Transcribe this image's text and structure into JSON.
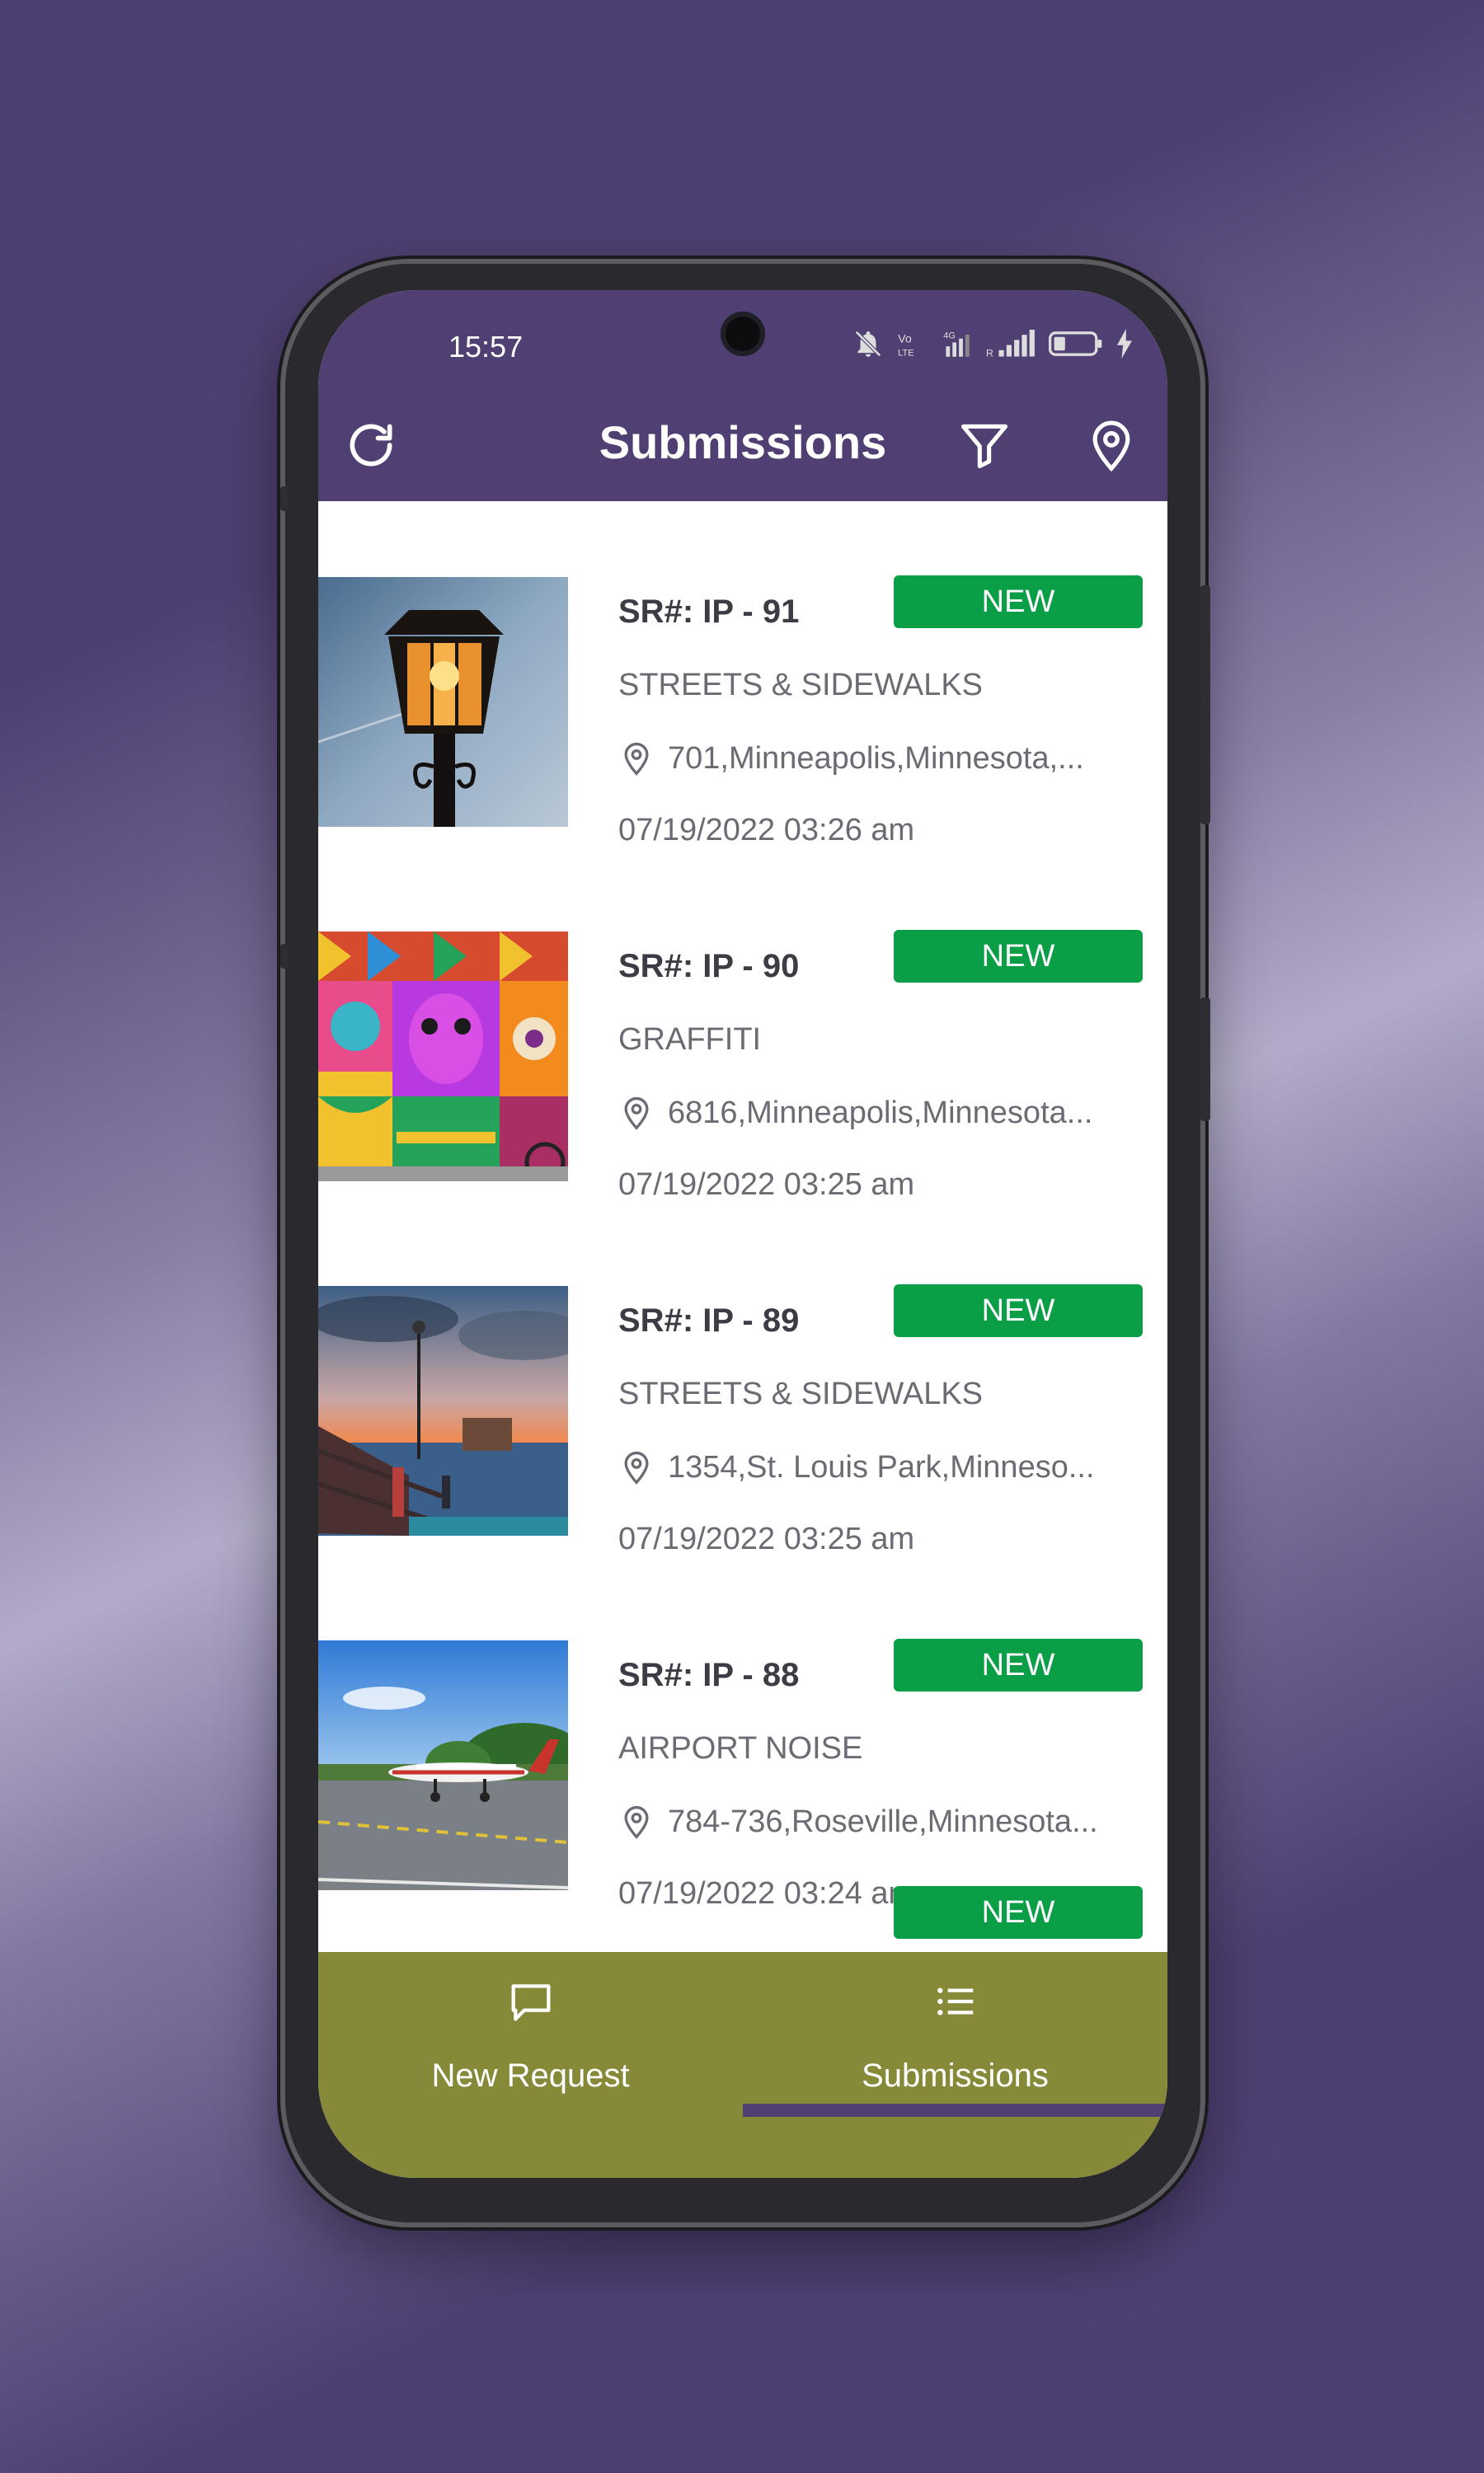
{
  "statusbar": {
    "time": "15:57"
  },
  "appbar": {
    "title": "Submissions"
  },
  "submissions": [
    {
      "sr": "SR#: IP - 91",
      "status": "NEW",
      "category": "STREETS & SIDEWALKS",
      "address": "701,Minneapolis,Minnesota,...",
      "date": "07/19/2022 03:26 am"
    },
    {
      "sr": "SR#: IP - 90",
      "status": "NEW",
      "category": "GRAFFITI",
      "address": "6816,Minneapolis,Minnesota...",
      "date": "07/19/2022 03:25 am"
    },
    {
      "sr": "SR#: IP - 89",
      "status": "NEW",
      "category": "STREETS & SIDEWALKS",
      "address": "1354,St. Louis Park,Minneso...",
      "date": "07/19/2022 03:25 am"
    },
    {
      "sr": "SR#: IP - 88",
      "status": "NEW",
      "category": "AIRPORT NOISE",
      "address": "784-736,Roseville,Minnesota...",
      "date": "07/19/2022 03:24 am"
    },
    {
      "sr": "",
      "status": "NEW",
      "category": "",
      "address": "",
      "date": ""
    }
  ],
  "bottom_nav": {
    "new_request": "New Request",
    "submissions": "Submissions",
    "active": "submissions"
  },
  "colors": {
    "primary": "#4f3f73",
    "badge_green": "#0a9e46",
    "nav_olive": "#868a38"
  }
}
